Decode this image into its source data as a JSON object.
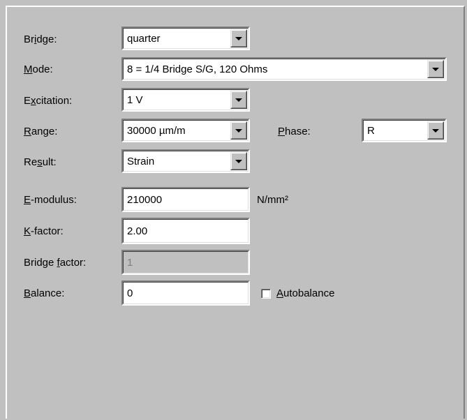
{
  "bridge": {
    "label_pre": "Br",
    "label_key": "i",
    "label_post": "dge:",
    "value": "quarter"
  },
  "mode": {
    "label_pre": "",
    "label_key": "M",
    "label_post": "ode:",
    "value": "8 = 1/4 Bridge S/G, 120 Ohms"
  },
  "excitation": {
    "label_pre": "E",
    "label_key": "x",
    "label_post": "citation:",
    "value": "1 V"
  },
  "range": {
    "label_pre": "",
    "label_key": "R",
    "label_post": "ange:",
    "value": "30000 µm/m"
  },
  "phase": {
    "label_pre": "",
    "label_key": "P",
    "label_post": "hase:",
    "value": "R"
  },
  "result": {
    "label_pre": "Re",
    "label_key": "s",
    "label_post": "ult:",
    "value": "Strain"
  },
  "emodulus": {
    "label_pre": "",
    "label_key": "E",
    "label_post": "-modulus:",
    "value": "210000",
    "unit": "N/mm²"
  },
  "kfactor": {
    "label_pre": "",
    "label_key": "K",
    "label_post": "-factor:",
    "value": "2.00"
  },
  "bridgefactor": {
    "label_pre": "Bridge ",
    "label_key": "f",
    "label_post": "actor:",
    "value": "1"
  },
  "balance": {
    "label_pre": "",
    "label_key": "B",
    "label_post": "alance:",
    "value": "0"
  },
  "autobalance": {
    "label_key": "A",
    "label_post": "utobalance",
    "checked": false
  },
  "colors": {
    "face": "#c0c0c0",
    "shadow": "#808080",
    "highlight": "#ffffff",
    "disabled_text": "#808080"
  },
  "icons": {
    "dropdown": "chevron-down-icon"
  }
}
